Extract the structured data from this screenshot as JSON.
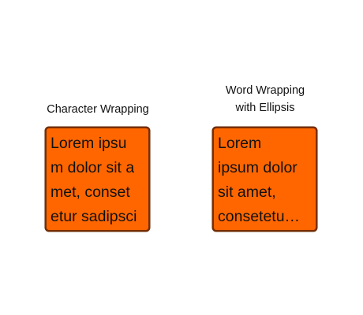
{
  "captions": {
    "character_wrapping": "Character Wrapping",
    "word_wrapping_line1": "Word Wrapping",
    "word_wrapping_line2": "with Ellipsis"
  },
  "character_box": {
    "lines": [
      "Lorem ipsu",
      "m dolor sit a",
      "met, conset",
      "etur sadipsci"
    ]
  },
  "word_box": {
    "lines": [
      "Lorem",
      "ipsum dolor",
      "sit amet,",
      "consetetu…"
    ]
  },
  "colors": {
    "box_fill": "#ff6600",
    "box_border": "#7a2e00",
    "text": "#111111",
    "background": "#ffffff"
  }
}
